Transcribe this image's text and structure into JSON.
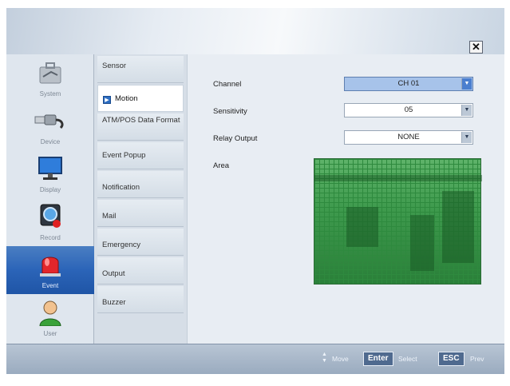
{
  "sidebar": {
    "items": [
      {
        "label": "System",
        "icon": "toolbox-icon"
      },
      {
        "label": "Device",
        "icon": "usb-cable-icon"
      },
      {
        "label": "Display",
        "icon": "monitor-icon"
      },
      {
        "label": "Record",
        "icon": "record-icon"
      },
      {
        "label": "Event",
        "icon": "siren-icon",
        "active": true
      },
      {
        "label": "User",
        "icon": "user-icon"
      }
    ]
  },
  "submenu": {
    "items": [
      {
        "label": "Sensor"
      },
      {
        "label": "Motion",
        "active": true
      },
      {
        "label": "ATM/POS Data Format"
      },
      {
        "label": "Event Popup"
      },
      {
        "label": "Notification"
      },
      {
        "label": "Mail"
      },
      {
        "label": "Emergency"
      },
      {
        "label": "Output"
      },
      {
        "label": "Buzzer"
      }
    ]
  },
  "form": {
    "channel_label": "Channel",
    "channel_value": "CH 01",
    "sensitivity_label": "Sensitivity",
    "sensitivity_value": "05",
    "relay_label": "Relay Output",
    "relay_value": "NONE",
    "area_label": "Area"
  },
  "footer": {
    "move_label": "Move",
    "enter_key": "Enter",
    "select_label": "Select",
    "esc_key": "ESC",
    "prev_label": "Prev"
  },
  "colors": {
    "accent": "#2b64b8",
    "grid_green": "#3e9a4d"
  }
}
